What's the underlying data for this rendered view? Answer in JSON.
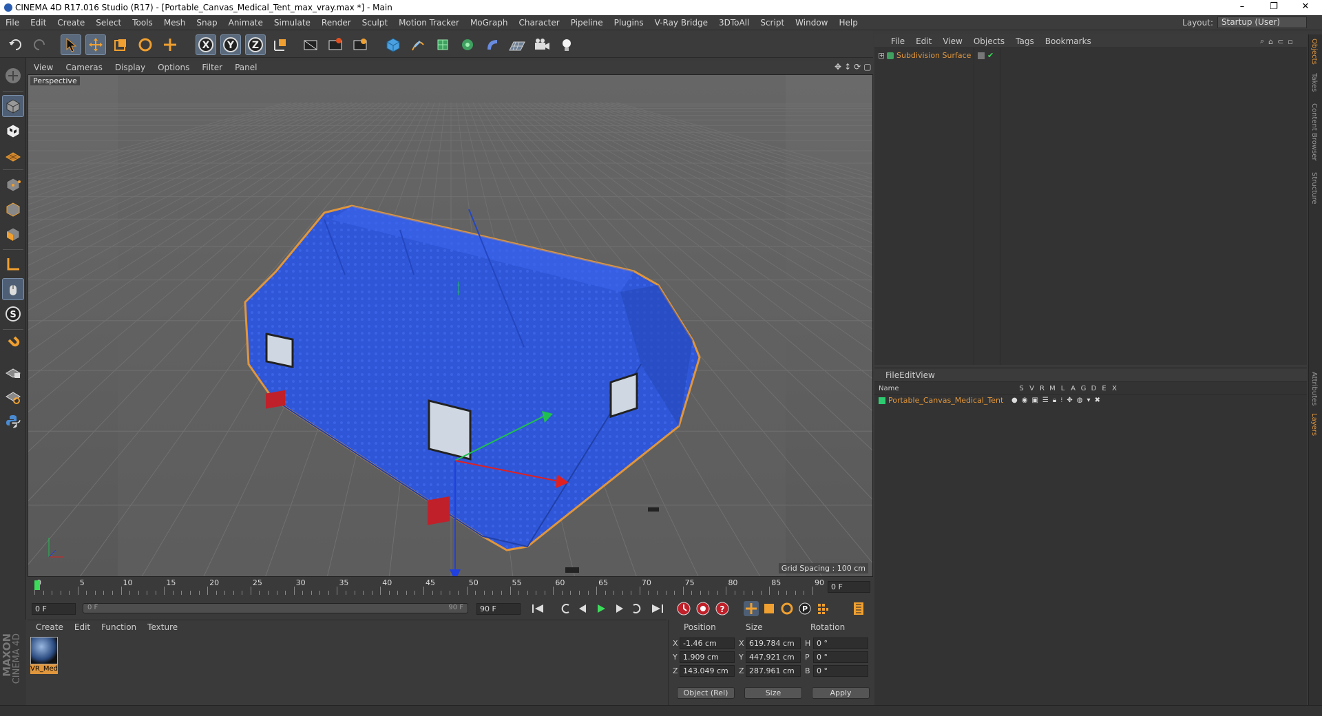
{
  "window": {
    "title": "CINEMA 4D R17.016 Studio (R17) - [Portable_Canvas_Medical_Tent_max_vray.max *] - Main"
  },
  "menu": [
    "File",
    "Edit",
    "Create",
    "Select",
    "Tools",
    "Mesh",
    "Snap",
    "Animate",
    "Simulate",
    "Render",
    "Sculpt",
    "Motion Tracker",
    "MoGraph",
    "Character",
    "Pipeline",
    "Plugins",
    "V-Ray Bridge",
    "3DToAll",
    "Script",
    "Window",
    "Help"
  ],
  "layout": {
    "label": "Layout:",
    "value": "Startup (User)"
  },
  "toolbar_axes": [
    "X",
    "Y",
    "Z"
  ],
  "viewport": {
    "menu": [
      "View",
      "Cameras",
      "Display",
      "Options",
      "Filter",
      "Panel"
    ],
    "label": "Perspective",
    "grid_spacing": "Grid Spacing : 100 cm"
  },
  "timeline": {
    "ticks": [
      "0",
      "5",
      "10",
      "15",
      "20",
      "25",
      "30",
      "35",
      "40",
      "45",
      "50",
      "55",
      "60",
      "65",
      "70",
      "75",
      "80",
      "85",
      "90"
    ],
    "current_frame": "0 F",
    "start": "0 F",
    "slider_start": "0 F",
    "slider_end": "90 F",
    "end": "90 F"
  },
  "material": {
    "menu": [
      "Create",
      "Edit",
      "Function",
      "Texture"
    ],
    "items": [
      {
        "name": "VR_Med"
      }
    ]
  },
  "coords": {
    "headers": [
      "Position",
      "Size",
      "Rotation"
    ],
    "rows": [
      {
        "axis": "X",
        "pos": "-1.46 cm",
        "size_axis": "X",
        "size": "619.784 cm",
        "rot_axis": "H",
        "rot": "0 °"
      },
      {
        "axis": "Y",
        "pos": "1.909 cm",
        "size_axis": "Y",
        "size": "447.921 cm",
        "rot_axis": "P",
        "rot": "0 °"
      },
      {
        "axis": "Z",
        "pos": "143.049 cm",
        "size_axis": "Z",
        "size": "287.961 cm",
        "rot_axis": "B",
        "rot": "0 °"
      }
    ],
    "mode": "Object (Rel)",
    "size_mode": "Size",
    "apply": "Apply"
  },
  "objects": {
    "menu": [
      "File",
      "Edit",
      "View",
      "Objects",
      "Tags",
      "Bookmarks"
    ],
    "items": [
      {
        "name": "Subdivision Surface"
      }
    ]
  },
  "layers": {
    "menu": [
      "File",
      "Edit",
      "View"
    ],
    "header": "Name",
    "cols": [
      "S",
      "V",
      "R",
      "M",
      "L",
      "A",
      "G",
      "D",
      "E",
      "X"
    ],
    "items": [
      {
        "name": "Portable_Canvas_Medical_Tent",
        "color": "#2ecc71"
      }
    ]
  },
  "side_tabs": [
    "Objects",
    "Takes",
    "Content Browser",
    "Structure",
    "Attributes",
    "Layers"
  ],
  "brand": {
    "line1": "MAXON",
    "line2": "CINEMA 4D"
  },
  "colors": {
    "accent_orange": "#e0963c",
    "object_green": "#2ecc71",
    "tent_blue": "#2f56d6"
  }
}
